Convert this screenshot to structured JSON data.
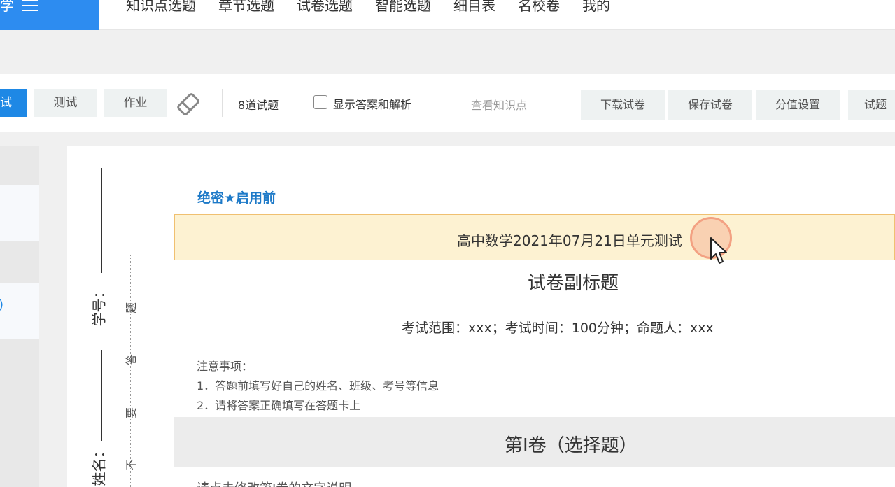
{
  "brand": {
    "label": "学"
  },
  "nav": {
    "items": [
      "知识点选题",
      "章节选题",
      "试卷选题",
      "智能选题",
      "细目表",
      "名校卷",
      "我的"
    ]
  },
  "toolbar": {
    "mode_active": "试",
    "mode_test": "测试",
    "mode_homework": "作业",
    "question_count": "8道试题",
    "show_answer_label": "显示答案和解析",
    "view_knowledge": "查看知识点",
    "download": "下载试卷",
    "save": "保存试卷",
    "score_settings": "分值设置",
    "question_partial": "试题"
  },
  "left_panel": {
    "paren": ")"
  },
  "paper": {
    "binding": {
      "student_id_label": "学号：",
      "name_label": "姓名：",
      "warning_chars": [
        "题",
        "答",
        "要",
        "不"
      ]
    },
    "secret_label": "绝密★启用前",
    "title": "高中数学2021年07月21日单元测试",
    "subtitle": "试卷副标题",
    "exam_info": "考试范围：xxx；考试时间：100分钟；命题人：xxx",
    "notes_title": "注意事项：",
    "notes": [
      "1．答题前填写好自己的姓名、班级、考号等信息",
      "2．请将答案正确填写在答题卡上"
    ],
    "section_title": "第I卷（选择题）",
    "section_desc": "请点击修改第I卷的文字说明"
  },
  "colors": {
    "brand_blue": "#2d8cf0",
    "active_blue": "#1e88e5",
    "secret_blue": "#1e7ac8",
    "title_bg": "#fdf2d2"
  }
}
